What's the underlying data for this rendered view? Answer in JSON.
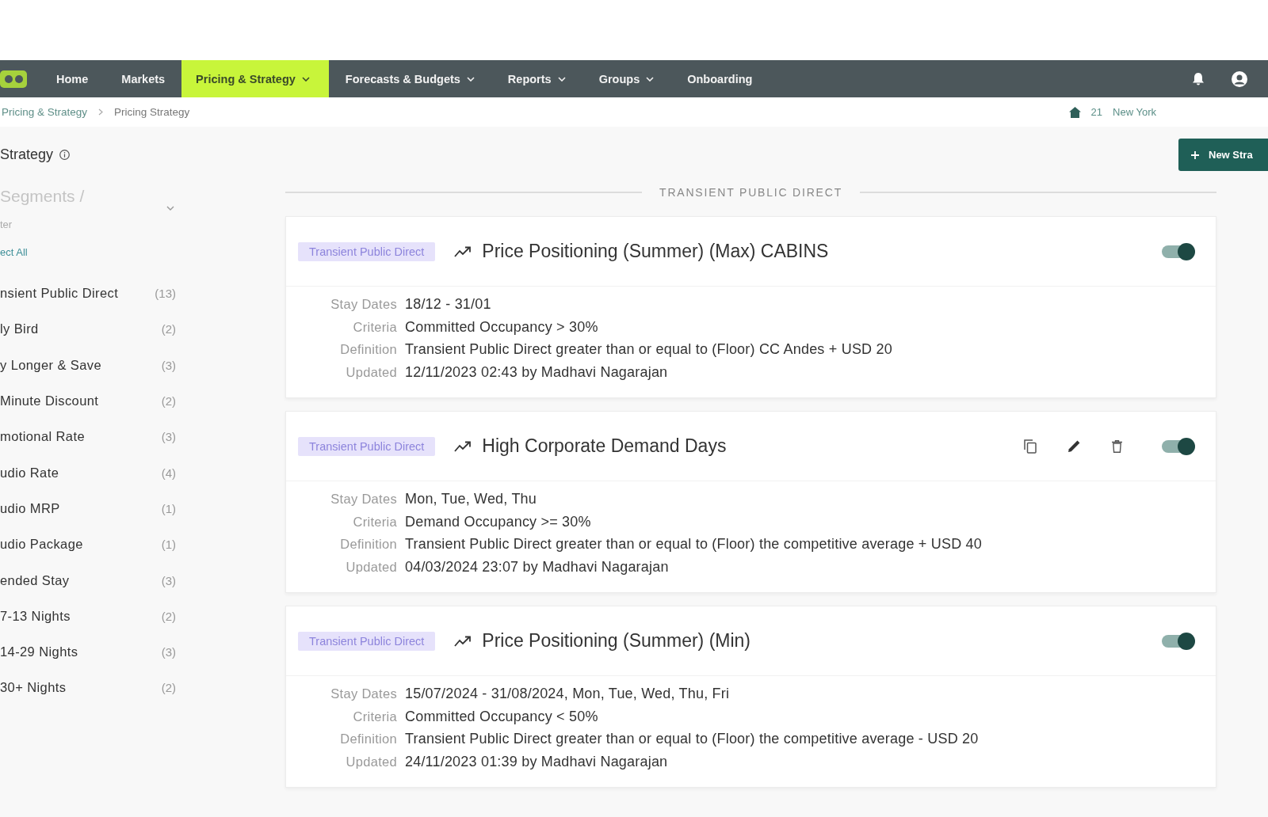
{
  "nav": {
    "items": [
      {
        "label": "Home",
        "selected": false,
        "dropdown": false
      },
      {
        "label": "Markets",
        "selected": false,
        "dropdown": false
      },
      {
        "label": "Pricing & Strategy",
        "selected": true,
        "dropdown": true
      },
      {
        "label": "Forecasts & Budgets",
        "selected": false,
        "dropdown": true
      },
      {
        "label": "Reports",
        "selected": false,
        "dropdown": true
      },
      {
        "label": "Groups",
        "selected": false,
        "dropdown": true
      },
      {
        "label": "Onboarding",
        "selected": false,
        "dropdown": false
      }
    ]
  },
  "breadcrumb": [
    "Pricing & Strategy",
    "Pricing Strategy"
  ],
  "property": {
    "code": "21",
    "name": "New York"
  },
  "sidebar": {
    "title": "Strategy",
    "search": {
      "placeholder": "Segments /"
    },
    "filter": {
      "label": "ter",
      "expanded": false
    },
    "select_all": "ect All",
    "items": [
      {
        "label": "nsient Public Direct",
        "count": "(13)"
      },
      {
        "label": "ly Bird",
        "count": "(2)"
      },
      {
        "label": "y Longer & Save",
        "count": "(3)"
      },
      {
        "label": "Minute Discount",
        "count": "(2)"
      },
      {
        "label": "motional Rate",
        "count": "(3)"
      },
      {
        "label": "udio Rate",
        "count": "(4)"
      },
      {
        "label": "udio MRP",
        "count": "(1)"
      },
      {
        "label": "udio Package",
        "count": "(1)"
      },
      {
        "label": "ended Stay",
        "count": "(3)"
      },
      {
        "label": "7-13 Nights",
        "count": "(2)"
      },
      {
        "label": "14-29 Nights",
        "count": "(3)"
      },
      {
        "label": "30+ Nights",
        "count": "(2)"
      }
    ]
  },
  "toolbar": {
    "button": "New Stra"
  },
  "section": {
    "title": "TRANSIENT PUBLIC DIRECT",
    "rules": [
      {
        "tag": "Transient Public Direct",
        "title": "Price Positioning (Summer) (Max) CABINS",
        "enabled": true,
        "actions_visible": false,
        "details": [
          {
            "label": "Stay Dates",
            "value": "18/12 - 31/01"
          },
          {
            "label": "Criteria",
            "value": "Committed Occupancy > 30%"
          },
          {
            "label": "Definition",
            "value": "Transient Public Direct greater than or equal to (Floor) CC Andes + USD 20"
          },
          {
            "label": "Updated",
            "value": "12/11/2023 02:43 by Madhavi Nagarajan"
          }
        ]
      },
      {
        "tag": "Transient Public Direct",
        "title": "High Corporate Demand Days",
        "enabled": true,
        "actions_visible": true,
        "details": [
          {
            "label": "Stay Dates",
            "value": "Mon, Tue, Wed, Thu"
          },
          {
            "label": "Criteria",
            "value": "Demand Occupancy >= 30%"
          },
          {
            "label": "Definition",
            "value": "Transient Public Direct greater than or equal to (Floor) the competitive average + USD 40"
          },
          {
            "label": "Updated",
            "value": "04/03/2024 23:07 by Madhavi Nagarajan"
          }
        ]
      },
      {
        "tag": "Transient Public Direct",
        "title": "Price Positioning (Summer) (Min)",
        "enabled": true,
        "actions_visible": false,
        "details": [
          {
            "label": "Stay Dates",
            "value": "15/07/2024 - 31/08/2024, Mon, Tue, Wed, Thu, Fri"
          },
          {
            "label": "Criteria",
            "value": "Committed Occupancy < 50%"
          },
          {
            "label": "Definition",
            "value": "Transient Public Direct greater than or equal to (Floor) the competitive average - USD 20"
          },
          {
            "label": "Updated",
            "value": "24/11/2023 01:39 by Madhavi Nagarajan"
          }
        ]
      }
    ]
  }
}
